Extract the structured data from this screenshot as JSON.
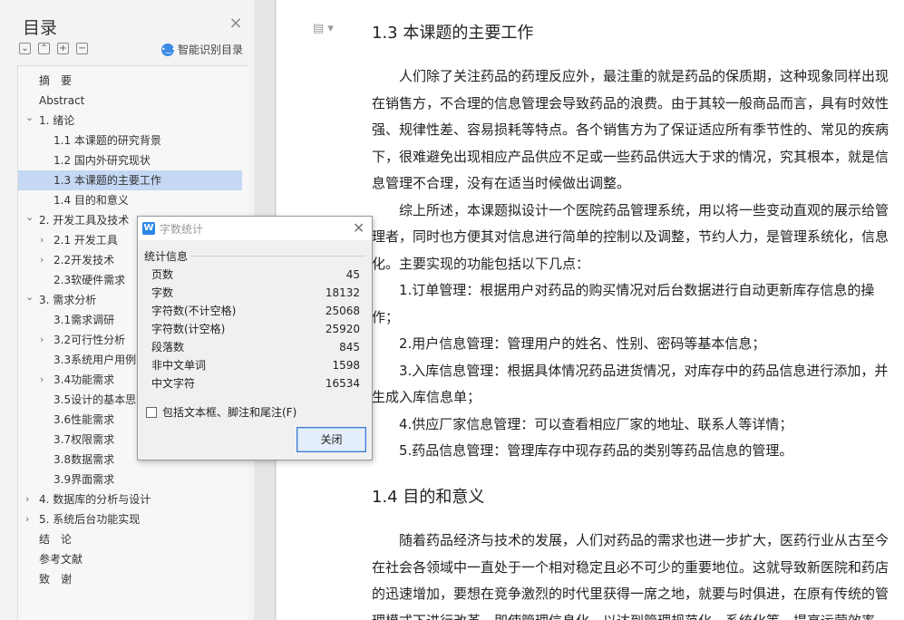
{
  "toc": {
    "title": "目录",
    "smart_label": "智能识别目录",
    "items": [
      {
        "label": "摘　要",
        "indent": 0,
        "arrow": ""
      },
      {
        "label": "Abstract",
        "indent": 0,
        "arrow": ""
      },
      {
        "label": "1. 绪论",
        "indent": 0,
        "arrow": "v"
      },
      {
        "label": "1.1  本课题的研究背景",
        "indent": 1,
        "arrow": ""
      },
      {
        "label": "1.2  国内外研究现状",
        "indent": 1,
        "arrow": ""
      },
      {
        "label": "1.3  本课题的主要工作",
        "indent": 1,
        "arrow": "",
        "selected": true
      },
      {
        "label": "1.4  目的和意义",
        "indent": 1,
        "arrow": ""
      },
      {
        "label": "2. 开发工具及技术",
        "indent": 0,
        "arrow": "v"
      },
      {
        "label": "2.1 开发工具",
        "indent": 1,
        "arrow": ">"
      },
      {
        "label": "2.2开发技术",
        "indent": 1,
        "arrow": ">"
      },
      {
        "label": "2.3软硬件需求",
        "indent": 1,
        "arrow": ""
      },
      {
        "label": "3. 需求分析",
        "indent": 0,
        "arrow": "v"
      },
      {
        "label": "3.1需求调研",
        "indent": 1,
        "arrow": ""
      },
      {
        "label": "3.2可行性分析",
        "indent": 1,
        "arrow": ">"
      },
      {
        "label": "3.3系统用户用例",
        "indent": 1,
        "arrow": ""
      },
      {
        "label": "3.4功能需求",
        "indent": 1,
        "arrow": ">"
      },
      {
        "label": "3.5设计的基本思",
        "indent": 1,
        "arrow": ""
      },
      {
        "label": "3.6性能需求",
        "indent": 1,
        "arrow": ""
      },
      {
        "label": "3.7权限需求",
        "indent": 1,
        "arrow": ""
      },
      {
        "label": "3.8数据需求",
        "indent": 1,
        "arrow": ""
      },
      {
        "label": "3.9界面需求",
        "indent": 1,
        "arrow": ""
      },
      {
        "label": "4. 数据库的分析与设计",
        "indent": 0,
        "arrow": ">"
      },
      {
        "label": "5. 系统后台功能实现",
        "indent": 0,
        "arrow": ">"
      },
      {
        "label": "结　论",
        "indent": 0,
        "arrow": ""
      },
      {
        "label": "参考文献",
        "indent": 0,
        "arrow": ""
      },
      {
        "label": "致　谢",
        "indent": 0,
        "arrow": ""
      }
    ]
  },
  "document": {
    "heading1": "1.3  本课题的主要工作",
    "lines1": [
      "　　人们除了关注药品的药理反应外，最注重的就是药品的保质期，这种现象同样出现",
      "在销售方，不合理的信息管理会导致药品的浪费。由于其较一般商品而言，具有时效性",
      "强、规律性差、容易损耗等特点。各个销售方为了保证适应所有季节性的、常见的疾病",
      "下，很难避免出现相应产品供应不足或一些药品供远大于求的情况，究其根本，就是信",
      "息管理不合理，没有在适当时候做出调整。",
      "　　综上所述，本课题拟设计一个医院药品管理系统，用以将一些变动直观的展示给管",
      "理者，同时也方便其对信息进行简单的控制以及调整，节约人力，是管理系统化，信息",
      "化。主要实现的功能包括以下几点：",
      "　　1.订单管理：根据用户对药品的购买情况对后台数据进行自动更新库存信息的操",
      "作；",
      "　　2.用户信息管理：管理用户的姓名、性别、密码等基本信息；",
      "　　3.入库信息管理：根据具体情况药品进货情况，对库存中的药品信息进行添加，并",
      "生成入库信息单；",
      "　　4.供应厂家信息管理：可以查看相应厂家的地址、联系人等详情；",
      "　　5.药品信息管理：管理库存中现存药品的类别等药品信息的管理。"
    ],
    "heading2": "1.4  目的和意义",
    "lines2": [
      "　　随着药品经济与技术的发展，人们对药品的需求也进一步扩大，医药行业从古至今",
      "在社会各领域中一直处于一个相对稳定且必不可少的重要地位。这就导致新医院和药店",
      "的迅速增加，要想在竞争激烈的时代里获得一席之地，就要与时俱进，在原有传统的管",
      "理模式下进行改革，即使管理信息化，以达到管理规范化、系统化等，提高运营效率。"
    ]
  },
  "dialog": {
    "title": "字数统计",
    "section_label": "统计信息",
    "stats": [
      {
        "label": "页数",
        "value": "45"
      },
      {
        "label": "字数",
        "value": "18132"
      },
      {
        "label": "字符数(不计空格)",
        "value": "25068"
      },
      {
        "label": "字符数(计空格)",
        "value": "25920"
      },
      {
        "label": "段落数",
        "value": "845"
      },
      {
        "label": "非中文单词",
        "value": "1598"
      },
      {
        "label": "中文字符",
        "value": "16534"
      }
    ],
    "checkbox_label": "包括文本框、脚注和尾注(F)",
    "close_label": "关闭"
  }
}
